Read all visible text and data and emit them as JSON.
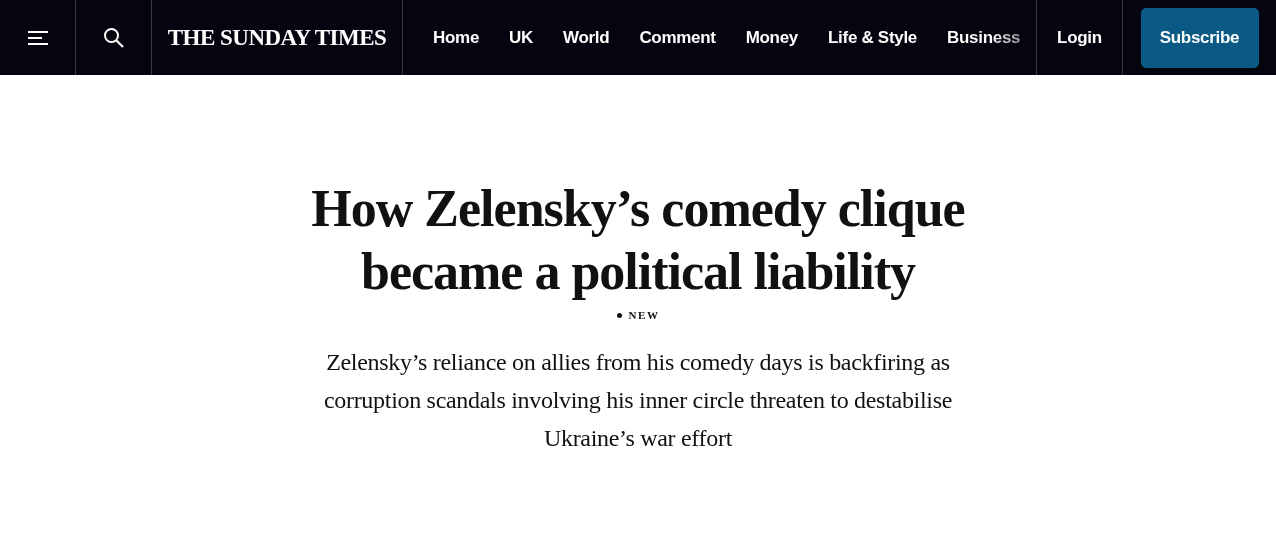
{
  "header": {
    "logo": "THE SUNDAY TIMES",
    "nav": [
      {
        "label": "Home"
      },
      {
        "label": "UK"
      },
      {
        "label": "World"
      },
      {
        "label": "Comment"
      },
      {
        "label": "Money"
      },
      {
        "label": "Life & Style"
      },
      {
        "label": "Business"
      }
    ],
    "login": "Login",
    "subscribe": "Subscribe"
  },
  "article": {
    "headline": "How Zelensky’s comedy clique became a political liability",
    "tag": "NEW",
    "standfirst": "Zelensky’s reliance on allies from his comedy days is backfiring as corruption scandals involving his inner circle threaten to destabilise Ukraine’s war effort"
  }
}
